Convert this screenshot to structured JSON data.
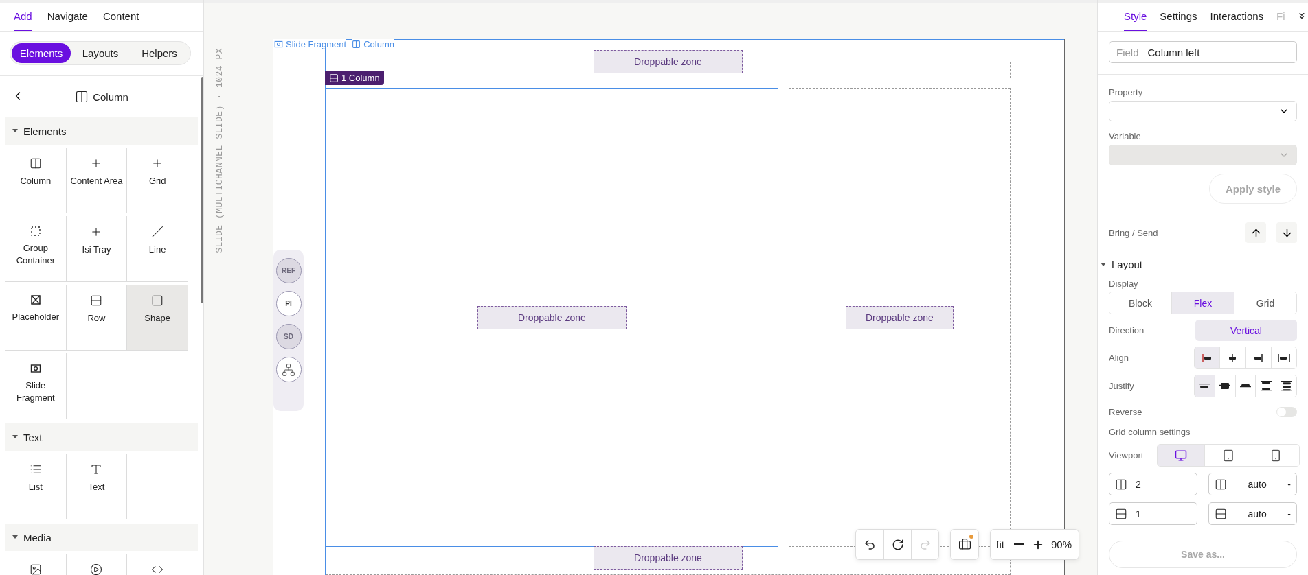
{
  "left_panel": {
    "tabs": [
      {
        "label": "Add",
        "selected": true
      },
      {
        "label": "Navigate",
        "selected": false
      },
      {
        "label": "Content",
        "selected": false
      }
    ],
    "subtabs": [
      {
        "label": "Elements",
        "selected": true
      },
      {
        "label": "Layouts",
        "selected": false
      },
      {
        "label": "Helpers",
        "selected": false
      }
    ],
    "header": {
      "title": "Column"
    },
    "sections": [
      {
        "title": "Elements",
        "expanded": true,
        "items": [
          {
            "label": "Column",
            "hovered": false
          },
          {
            "label": "Content Area",
            "hovered": false
          },
          {
            "label": "Grid",
            "hovered": false
          },
          {
            "label": "Group Container",
            "hovered": false
          },
          {
            "label": "Isi Tray",
            "hovered": false
          },
          {
            "label": "Line",
            "hovered": false
          },
          {
            "label": "Placeholder",
            "hovered": false
          },
          {
            "label": "Row",
            "hovered": false
          },
          {
            "label": "Shape",
            "hovered": true
          },
          {
            "label": "Slide Fragment",
            "hovered": false
          }
        ]
      },
      {
        "title": "Text",
        "expanded": true,
        "items": [
          {
            "label": "List",
            "hovered": false
          },
          {
            "label": "Text",
            "hovered": false
          }
        ]
      },
      {
        "title": "Media",
        "expanded": true,
        "items": [
          {
            "hovered": false
          },
          {
            "hovered": false
          },
          {
            "hovered": false
          }
        ]
      }
    ]
  },
  "canvas": {
    "size_label": "SLIDE (MULTICHANNEL SLIDE) · 1024 PX",
    "side_buttons": [
      {
        "kind": "text",
        "label": "REF",
        "active": false
      },
      {
        "kind": "text",
        "label": "PI",
        "active": true
      },
      {
        "kind": "text",
        "label": "SD",
        "active": false
      },
      {
        "kind": "icon",
        "active": true
      }
    ],
    "outline_labels": [
      "Slide Fragment",
      "Column"
    ],
    "selection_badge": "1 Column",
    "top_zone": {
      "label": "Droppable zone"
    },
    "columns": [
      {
        "label": "Droppable zone",
        "selected": true
      },
      {
        "label": "Droppable zone",
        "selected": false
      }
    ],
    "bottom_zone": {
      "label": "Droppable zone"
    },
    "history_buttons": [
      {
        "disabled": false
      },
      {
        "disabled": false
      },
      {
        "disabled": true
      }
    ],
    "briefcase": {
      "notification": true
    },
    "zoom": {
      "fit_label": "fit",
      "value": "90%"
    }
  },
  "right_panel": {
    "tabs": [
      {
        "label": "Style",
        "selected": true
      },
      {
        "label": "Settings",
        "selected": false
      },
      {
        "label": "Interactions",
        "selected": false
      },
      {
        "label": "Fi",
        "selected": false
      }
    ],
    "field": {
      "label": "Field",
      "value": "Column left"
    },
    "property": {
      "label": "Property",
      "disabled": false
    },
    "variable": {
      "label": "Variable",
      "disabled": true
    },
    "apply_button": {
      "label": "Apply style",
      "disabled": true
    },
    "bring_send": {
      "label": "Bring / Send"
    },
    "layout": {
      "title": "Layout",
      "expanded": true,
      "display": {
        "label": "Display",
        "options": [
          {
            "label": "Block",
            "selected": false
          },
          {
            "label": "Flex",
            "selected": true
          },
          {
            "label": "Grid",
            "selected": false
          }
        ]
      },
      "direction": {
        "label": "Direction",
        "value": "Vertical"
      },
      "align": {
        "label": "Align",
        "options": [
          {
            "selected": true
          },
          {
            "selected": false
          },
          {
            "selected": false
          },
          {
            "selected": false
          }
        ]
      },
      "justify": {
        "label": "Justify",
        "options": [
          {
            "selected": true
          },
          {
            "selected": false
          },
          {
            "selected": false
          },
          {
            "selected": false
          },
          {
            "selected": false
          }
        ]
      },
      "reverse": {
        "label": "Reverse",
        "on": false
      },
      "grid_title": "Grid column settings",
      "viewport": {
        "label": "Viewport",
        "options": [
          {
            "selected": true
          },
          {
            "selected": false
          },
          {
            "selected": false
          }
        ]
      },
      "grid_inputs": [
        {
          "value": "2"
        },
        {
          "value": "auto",
          "suffix": "-"
        },
        {
          "value": "1"
        },
        {
          "value": "auto",
          "suffix": "-"
        }
      ]
    },
    "save_button": {
      "label": "Save as...",
      "disabled": true
    }
  }
}
